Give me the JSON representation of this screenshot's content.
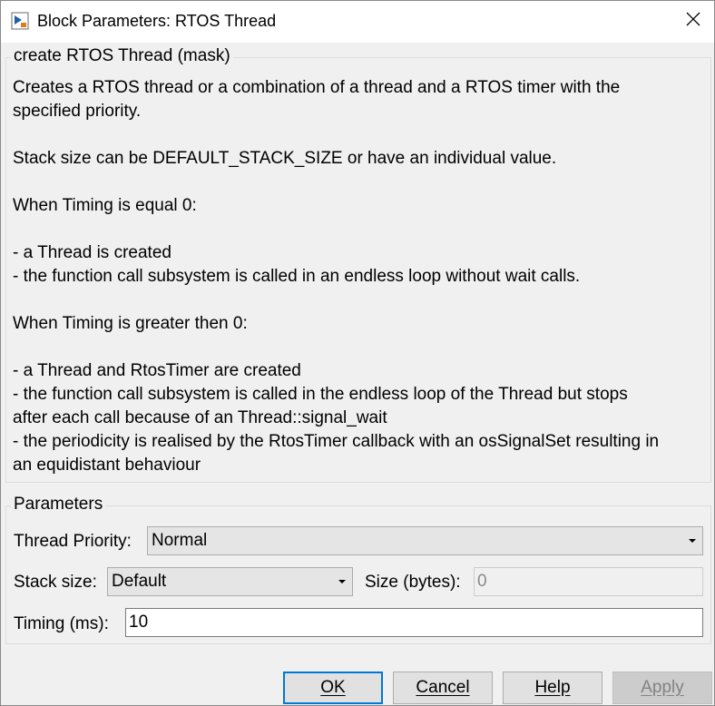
{
  "window": {
    "title": "Block Parameters: RTOS Thread",
    "icon": "simulink-block-icon",
    "close_icon": "close-icon"
  },
  "description": {
    "legend": "create RTOS Thread (mask)",
    "lines": [
      "Creates a RTOS thread or a combination of a thread and a RTOS timer with the",
      "specified priority.",
      "",
      "Stack size can be DEFAULT_STACK_SIZE or have an individual value.",
      "",
      "When Timing is equal 0:",
      "",
      "- a Thread is created",
      "- the function call subsystem is called in an endless loop without wait calls.",
      "",
      "When Timing is greater then 0:",
      "",
      "- a Thread and RtosTimer are created",
      "- the function call subsystem is called in the endless loop of the Thread but stops",
      "after each call because of an Thread::signal_wait",
      "- the periodicity is realised by the RtosTimer callback with an osSignalSet resulting in",
      "an equidistant behaviour"
    ]
  },
  "parameters": {
    "legend": "Parameters",
    "thread_priority": {
      "label": "Thread Priority:",
      "value": "Normal"
    },
    "stack_size": {
      "label": "Stack size:",
      "value": "Default"
    },
    "size_bytes": {
      "label": "Size (bytes):",
      "value": "0"
    },
    "timing": {
      "label": "Timing (ms):",
      "value": "10"
    }
  },
  "buttons": {
    "ok": "OK",
    "cancel": "Cancel",
    "help": "Help",
    "apply": "Apply"
  },
  "colors": {
    "default_button_border": "#0078d7",
    "dialog_background": "#f0f0f0"
  }
}
